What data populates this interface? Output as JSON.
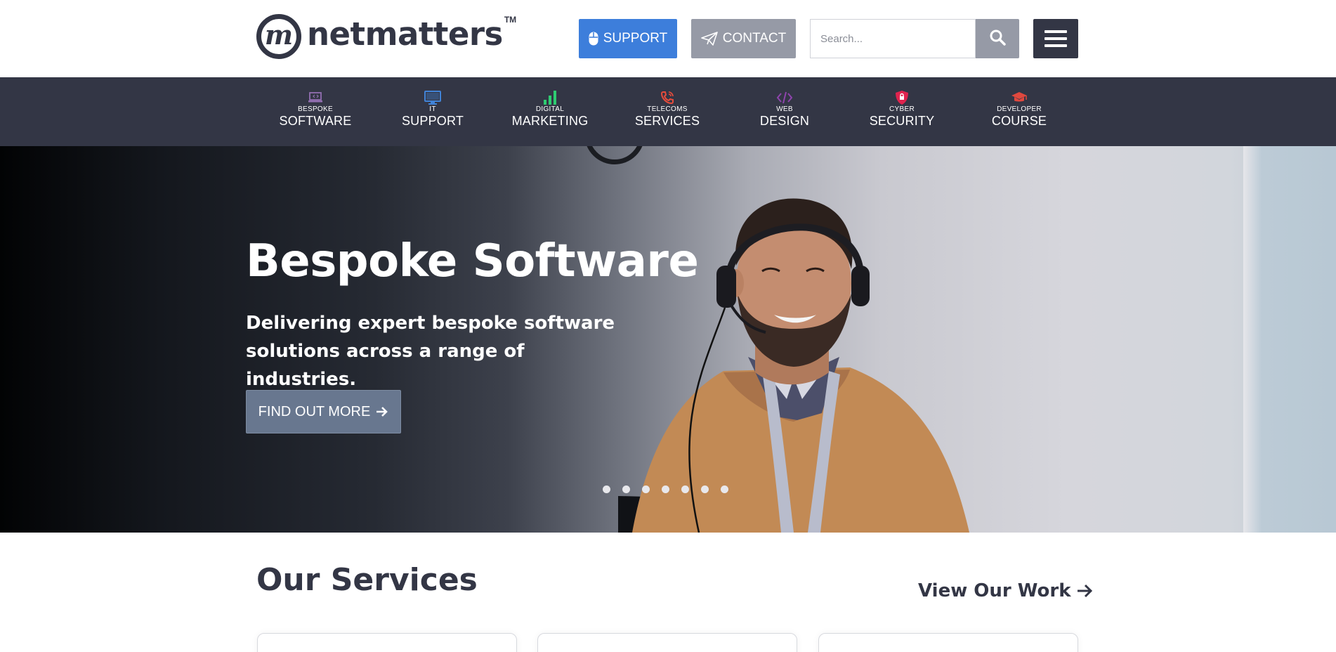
{
  "header": {
    "logo_text": "netmatters",
    "logo_mark": "m",
    "logo_tm": "TM",
    "support_label": "SUPPORT",
    "contact_label": "CONTACT",
    "search_placeholder": "Search...",
    "icons": {
      "support": "mouse-icon",
      "contact": "paper-plane-icon",
      "search": "search-icon",
      "menu": "hamburger-menu-icon"
    }
  },
  "nav": {
    "items": [
      {
        "small": "BESPOKE",
        "big": "SOFTWARE",
        "icon": "laptop-code-icon",
        "color": "#926fb1"
      },
      {
        "small": "IT",
        "big": "SUPPORT",
        "icon": "desktop-icon",
        "color": "#4183d7"
      },
      {
        "small": "DIGITAL",
        "big": "MARKETING",
        "icon": "bar-chart-icon",
        "color": "#2ecc71"
      },
      {
        "small": "TELECOMS",
        "big": "SERVICES",
        "icon": "phone-volume-icon",
        "color": "#e74c3c"
      },
      {
        "small": "WEB",
        "big": "DESIGN",
        "icon": "code-icon",
        "color": "#8e44ad"
      },
      {
        "small": "CYBER",
        "big": "SECURITY",
        "icon": "shield-icon",
        "color": "#e0234e"
      },
      {
        "small": "DEVELOPER",
        "big": "COURSE",
        "icon": "graduation-cap-icon",
        "color": "#e0483e"
      }
    ]
  },
  "hero": {
    "title": "Bespoke Software",
    "subtitle": "Delivering expert bespoke software solutions across a range of industries.",
    "cta_label": "FIND OUT MORE",
    "slide_count": 7
  },
  "services": {
    "title": "Our Services",
    "view_work_label": "View Our Work"
  },
  "colors": {
    "brand_dark": "#333645",
    "support_blue": "#3d7edb",
    "contact_grey": "#969aa6",
    "cta": "#68778f"
  }
}
